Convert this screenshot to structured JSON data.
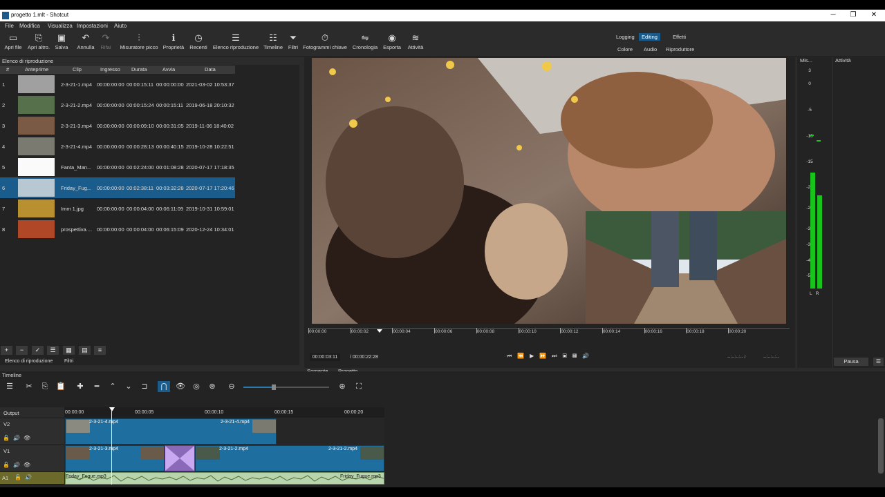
{
  "window": {
    "title": "progetto 1.mlt - Shotcut",
    "minimize": "─",
    "maximize": "❐",
    "close": "✕"
  },
  "menu": [
    "File",
    "Modifica",
    "Visualizza",
    "Impostazioni",
    "Aiuto"
  ],
  "toolbar": [
    {
      "label": "Apri file",
      "icon": "folder-icon"
    },
    {
      "label": "Apri altro.",
      "icon": "open-other-icon"
    },
    {
      "label": "Salva",
      "icon": "save-icon"
    },
    {
      "label": "Annulla",
      "icon": "undo-icon"
    },
    {
      "label": "Rifai",
      "icon": "redo-icon"
    },
    {
      "label": "Misuratore picco",
      "icon": "peak-meter-icon"
    },
    {
      "label": "Proprietà",
      "icon": "info-icon"
    },
    {
      "label": "Recenti",
      "icon": "clock-icon"
    },
    {
      "label": "Elenco riproduzione",
      "icon": "playlist-icon"
    },
    {
      "label": "Timeline",
      "icon": "timeline-icon"
    },
    {
      "label": "Filtri",
      "icon": "filter-icon"
    },
    {
      "label": "Fotogrammi chiave",
      "icon": "keyframes-icon"
    },
    {
      "label": "Cronologia",
      "icon": "history-icon"
    },
    {
      "label": "Esporta",
      "icon": "export-icon"
    },
    {
      "label": "Attività",
      "icon": "jobs-icon"
    }
  ],
  "layouts": {
    "logging": "Logging",
    "editing": "Editing",
    "effetti": "Effetti",
    "colore": "Colore",
    "audio": "Audio",
    "riproduttore": "Riproduttore"
  },
  "playlist": {
    "title": "Elenco di riproduzione",
    "columns": [
      "#",
      "Anteprime",
      "Clip",
      "Ingresso",
      "Durata",
      "Avvia",
      "Data"
    ],
    "rows": [
      {
        "n": "1",
        "clip": "2-3-21-1.mp4",
        "in": "00:00:00:00",
        "dur": "00:00:15:11",
        "start": "00:00:00:00",
        "date": "2021-03-02 10:53:37"
      },
      {
        "n": "2",
        "clip": "2-3-21-2.mp4",
        "in": "00:00:00:00",
        "dur": "00:00:15:24",
        "start": "00:00:15:11",
        "date": "2019-06-18 20:10:32"
      },
      {
        "n": "3",
        "clip": "2-3-21-3.mp4",
        "in": "00:00:00:00",
        "dur": "00:00:09:10",
        "start": "00:00:31:05",
        "date": "2019-11-06 18:40:02"
      },
      {
        "n": "4",
        "clip": "2-3-21-4.mp4",
        "in": "00:00:00:00",
        "dur": "00:00:28:13",
        "start": "00:00:40:15",
        "date": "2019-10-28 10:22:51"
      },
      {
        "n": "5",
        "clip": "Fanta_Man...",
        "in": "00:00:00:00",
        "dur": "00:02:24:00",
        "start": "00:01:08:28",
        "date": "2020-07-17 17:18:35"
      },
      {
        "n": "6",
        "clip": "Friday_Fug...",
        "in": "00:00:00:00",
        "dur": "00:02:38:11",
        "start": "00:03:32:28",
        "date": "2020-07-17 17:20:46"
      },
      {
        "n": "7",
        "clip": "Imm 1.jpg",
        "in": "00:00:00:00",
        "dur": "00:00:04:00",
        "start": "00:06:11:09",
        "date": "2019-10-31 10:59:01"
      },
      {
        "n": "8",
        "clip": "prospettiva....",
        "in": "00:00:00:00",
        "dur": "00:00:04:00",
        "start": "00:06:15:09",
        "date": "2020-12-24 10:34:01"
      }
    ],
    "selected_row": 6,
    "tabs": [
      "Elenco di riproduzione",
      "Filtri"
    ],
    "buttons": [
      "+",
      "−",
      "✓",
      "☰",
      "▦",
      "▤",
      "≡"
    ]
  },
  "player": {
    "ticks": [
      "00:00:00",
      "00:00:02",
      "00:00:04",
      "00:00:06",
      "00:00:08",
      "00:00:10",
      "00:00:12",
      "00:00:14",
      "00:00:16",
      "00:00:18",
      "00:00:20"
    ],
    "position": "00:00:03:11",
    "duration": "/ 00:00:22:28",
    "in_point": "--:--:--:-- /",
    "out_point": "--:--:--:--",
    "tabs": [
      "Sorgente",
      "Progetto"
    ]
  },
  "meter": {
    "title": "Mis...",
    "labels": [
      "3",
      "0",
      "-5",
      "-10",
      "-15",
      "-20",
      "-25",
      "-30",
      "-35",
      "-40",
      "-50"
    ],
    "channels": "L   R",
    "left_level": 0.86,
    "right_level": 0.69
  },
  "activity": {
    "title": "Attività",
    "pause": "Pausa"
  },
  "timeline": {
    "title": "Timeline",
    "ruler": [
      "00:00:00",
      "00:00:05",
      "00:00:10",
      "00:00:15",
      "00:00:20"
    ],
    "tracks": [
      "Output",
      "V2",
      "V1",
      "A1"
    ],
    "clips": {
      "v2a": "2-3-21-4.mp4",
      "v2b": "2-3-21-4.mp4",
      "v1a": "2-3-21-3.mp4",
      "v1b": "2-3-21-2.mp4",
      "v1c": "2-3-21-2.mp4",
      "a1a": "Friday_Fugue.mp3",
      "a1b": "Friday_Fugue.mp3"
    }
  },
  "colors": {
    "accent": "#1a5c8c",
    "clip": "#1e6fa0",
    "audio": "#b8d4ac",
    "meter": "#18c41b"
  }
}
